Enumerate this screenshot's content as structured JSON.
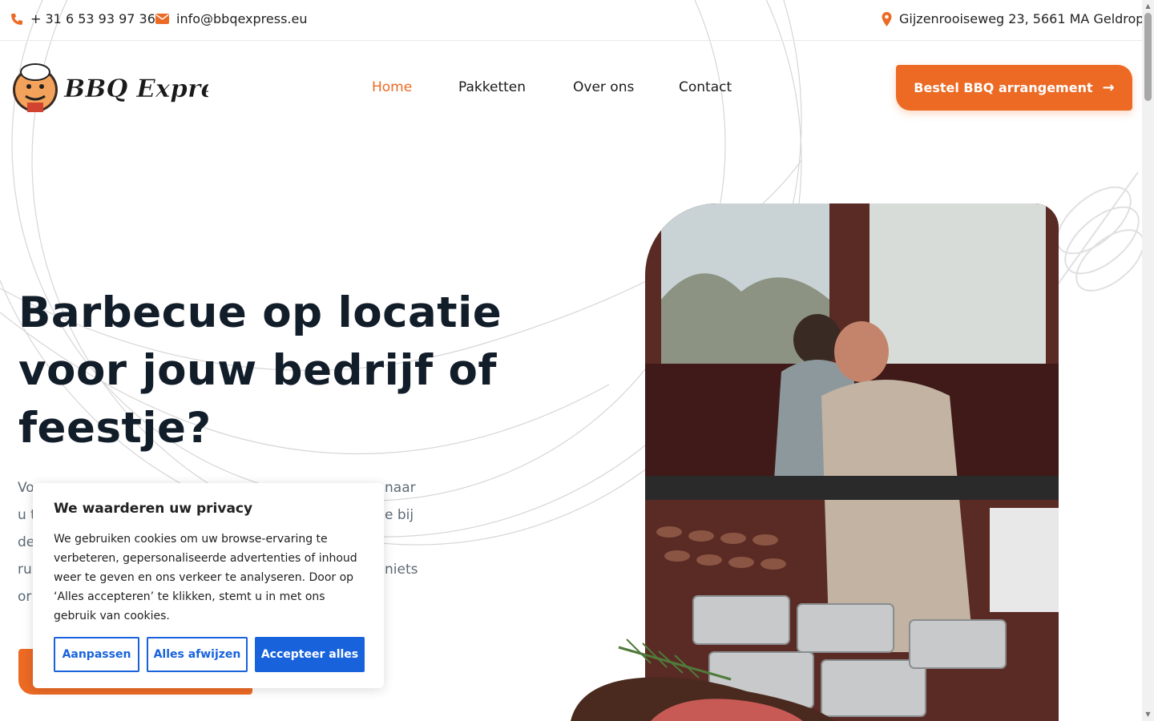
{
  "topbar": {
    "phone": "+ 31 6 53 93 97 36",
    "email": "info@bbqexpress.eu",
    "address": "Gijzenrooiseweg 23, 5661 MA Geldrop"
  },
  "logo": {
    "text": "BBQ Express"
  },
  "nav": {
    "items": [
      {
        "label": "Home",
        "active": true
      },
      {
        "label": "Pakketten",
        "active": false
      },
      {
        "label": "Over ons",
        "active": false
      },
      {
        "label": "Contact",
        "active": false
      }
    ],
    "cta_label": "Bestel BBQ arrangement"
  },
  "hero": {
    "title_lines": [
      "Barbecue op locatie",
      "voor jouw bedrijf of",
      "feestje?"
    ],
    "text_lines": [
      "Voo",
      "u t",
      "de",
      "ru",
      "or"
    ],
    "text_right_fragments": [
      "naar",
      "e bij",
      "niets"
    ]
  },
  "cookie": {
    "title": "We waarderen uw privacy",
    "body": "We gebruiken cookies om uw browse-ervaring te verbeteren, gepersonaliseerde advertenties of inhoud weer te geven en ons verkeer te analyseren. Door op ‘Alles accepteren’ te klikken, stemt u in met ons gebruik van cookies.",
    "customize": "Aanpassen",
    "reject": "Alles afwijzen",
    "accept": "Accepteer alles"
  },
  "colors": {
    "accent": "#ec6a24",
    "cookie_blue": "#1863dc",
    "heading": "#121d2a"
  }
}
